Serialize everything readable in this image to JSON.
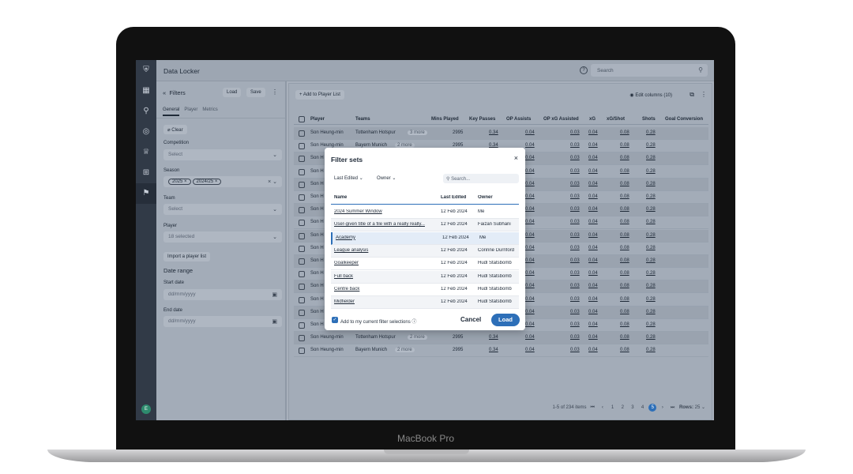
{
  "device_label": "MacBook Pro",
  "app": {
    "title": "Data Locker",
    "search_placeholder": "Search",
    "avatar_initial": "E"
  },
  "rail_icons": [
    "shield-logo",
    "grid-icon",
    "runner-icon",
    "badge-icon",
    "trophy-icon",
    "board-icon",
    "player-icon"
  ],
  "filters": {
    "back": "«",
    "heading": "Filters",
    "load_label": "Load",
    "save_label": "Save",
    "tabs": [
      "General",
      "Player",
      "Metrics"
    ],
    "clear_label": "Clear",
    "competition_label": "Competition",
    "competition_placeholder": "Select",
    "season_label": "Season",
    "season_chips": [
      "2025",
      "2024/25"
    ],
    "team_label": "Team",
    "team_placeholder": "Select",
    "player_label": "Player",
    "player_value": "18 selected",
    "import_label": "Import a player list",
    "date_range_label": "Date range",
    "start_label": "Start date",
    "start_placeholder": "dd/mm/yyyy",
    "end_label": "End date",
    "end_placeholder": "dd/mm/yyyy"
  },
  "main": {
    "add_label": "+ Add to Player List",
    "edit_columns": "Edit columns (10)",
    "columns": [
      "Player",
      "Teams",
      "Mins Played",
      "Key Passes",
      "OP Assists",
      "OP xG Assisted",
      "xG",
      "xG/Shot",
      "Shots",
      "Goal Conversion"
    ],
    "rows": [
      {
        "player": "Son Heung-min",
        "team": "Tottenham Hotspur",
        "more": "3 more",
        "mins": "2995",
        "kp": "0.34",
        "opa": "0.04",
        "xga": "0.03",
        "xg": "0.04",
        "xgs": "0.08",
        "shots": "0.28"
      },
      {
        "player": "Son Heung-min",
        "team": "Bayern Munich",
        "more": "2 more",
        "mins": "2995",
        "kp": "0.34",
        "opa": "0.04",
        "xga": "0.03",
        "xg": "0.04",
        "xgs": "0.08",
        "shots": "0.28"
      },
      {
        "player": "Son H",
        "team": "",
        "more": "",
        "mins": "",
        "kp": "",
        "opa": "0.04",
        "xga": "0.03",
        "xg": "0.04",
        "xgs": "0.08",
        "shots": "0.28"
      },
      {
        "player": "Son H",
        "team": "",
        "more": "",
        "mins": "",
        "kp": "",
        "opa": "0.04",
        "xga": "0.03",
        "xg": "0.04",
        "xgs": "0.08",
        "shots": "0.28"
      },
      {
        "player": "Son H",
        "team": "",
        "more": "",
        "mins": "",
        "kp": "",
        "opa": "0.04",
        "xga": "0.03",
        "xg": "0.04",
        "xgs": "0.08",
        "shots": "0.28"
      },
      {
        "player": "Son H",
        "team": "",
        "more": "",
        "mins": "",
        "kp": "",
        "opa": "0.04",
        "xga": "0.03",
        "xg": "0.04",
        "xgs": "0.08",
        "shots": "0.28"
      },
      {
        "player": "Son H",
        "team": "",
        "more": "",
        "mins": "",
        "kp": "",
        "opa": "0.04",
        "xga": "0.03",
        "xg": "0.04",
        "xgs": "0.08",
        "shots": "0.28"
      },
      {
        "player": "Son H",
        "team": "",
        "more": "",
        "mins": "",
        "kp": "",
        "opa": "0.04",
        "xga": "0.03",
        "xg": "0.04",
        "xgs": "0.08",
        "shots": "0.28"
      },
      {
        "player": "Son H",
        "team": "",
        "more": "",
        "mins": "",
        "kp": "",
        "opa": "0.04",
        "xga": "0.03",
        "xg": "0.04",
        "xgs": "0.08",
        "shots": "0.28"
      },
      {
        "player": "Son H",
        "team": "",
        "more": "",
        "mins": "",
        "kp": "",
        "opa": "0.04",
        "xga": "0.03",
        "xg": "0.04",
        "xgs": "0.08",
        "shots": "0.28"
      },
      {
        "player": "Son H",
        "team": "",
        "more": "",
        "mins": "",
        "kp": "",
        "opa": "0.04",
        "xga": "0.03",
        "xg": "0.04",
        "xgs": "0.08",
        "shots": "0.28"
      },
      {
        "player": "Son H",
        "team": "",
        "more": "",
        "mins": "",
        "kp": "",
        "opa": "0.04",
        "xga": "0.03",
        "xg": "0.04",
        "xgs": "0.08",
        "shots": "0.28"
      },
      {
        "player": "Son H",
        "team": "",
        "more": "",
        "mins": "",
        "kp": "",
        "opa": "0.04",
        "xga": "0.03",
        "xg": "0.04",
        "xgs": "0.08",
        "shots": "0.28"
      },
      {
        "player": "Son H",
        "team": "",
        "more": "",
        "mins": "",
        "kp": "",
        "opa": "0.04",
        "xga": "0.03",
        "xg": "0.04",
        "xgs": "0.08",
        "shots": "0.28"
      },
      {
        "player": "Son H",
        "team": "",
        "more": "",
        "mins": "",
        "kp": "",
        "opa": "0.04",
        "xga": "0.03",
        "xg": "0.04",
        "xgs": "0.08",
        "shots": "0.28"
      },
      {
        "player": "Son H",
        "team": "",
        "more": "",
        "mins": "",
        "kp": "",
        "opa": "0.04",
        "xga": "0.03",
        "xg": "0.04",
        "xgs": "0.08",
        "shots": "0.28"
      },
      {
        "player": "Son Heung-min",
        "team": "Tottenham Hotspur",
        "more": "2 more",
        "mins": "2995",
        "kp": "0.34",
        "opa": "0.04",
        "xga": "0.03",
        "xg": "0.04",
        "xgs": "0.08",
        "shots": "0.28"
      },
      {
        "player": "Son Heung-min",
        "team": "Bayern Munich",
        "more": "2 more",
        "mins": "2995",
        "kp": "0.34",
        "opa": "0.04",
        "xga": "0.03",
        "xg": "0.04",
        "xgs": "0.08",
        "shots": "0.28"
      }
    ],
    "pager_text": "1-5 of 234 items",
    "pages": [
      "1",
      "2",
      "3",
      "4",
      "5"
    ],
    "current_page": "5",
    "rows_label": "Rows:",
    "rows_value": "25"
  },
  "modal": {
    "title": "Filter sets",
    "close": "×",
    "sort_label": "Last Edited",
    "owner_filter": "Owner",
    "search_placeholder": "Search...",
    "headers": [
      "Name",
      "Last Edited",
      "Owner"
    ],
    "rows": [
      {
        "name": "2024 Summer Window",
        "date": "12 Feb 2024",
        "owner": "Me"
      },
      {
        "name": "User-given title of a file with a really really...",
        "date": "12 Feb 2024",
        "owner": "Faizan Subhani"
      },
      {
        "name": "Academy",
        "date": "12 Feb 2024",
        "owner": "Me"
      },
      {
        "name": "League analysis",
        "date": "12 Feb 2024",
        "owner": "Corinne Durnford"
      },
      {
        "name": "Goalkeeper",
        "date": "12 Feb 2024",
        "owner": "Hudl Statsbomb"
      },
      {
        "name": "Full back",
        "date": "12 Feb 2024",
        "owner": "Hudl Statsbomb"
      },
      {
        "name": "Centre back",
        "date": "12 Feb 2024",
        "owner": "Hudl Statsbomb"
      },
      {
        "name": "Midfielder",
        "date": "12 Feb 2024",
        "owner": "Hudl Statsbomb"
      }
    ],
    "selected_index": 2,
    "checkbox_label": "Add to my current filter selections",
    "cancel_label": "Cancel",
    "load_label": "Load"
  }
}
